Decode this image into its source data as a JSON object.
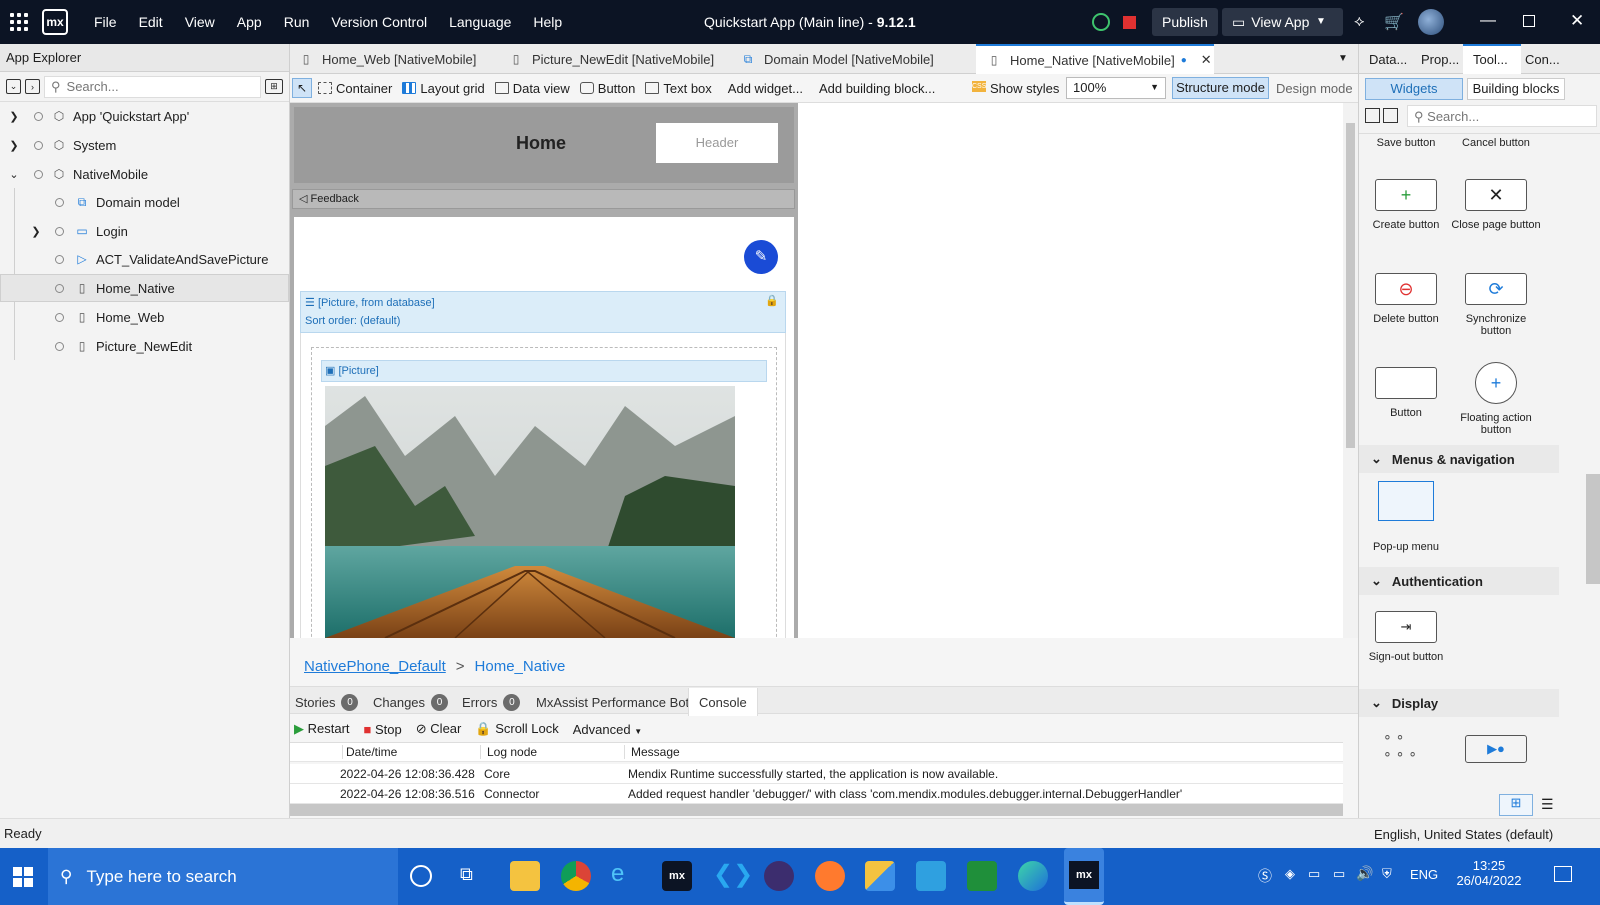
{
  "title_bar": {
    "menus": [
      "File",
      "Edit",
      "View",
      "App",
      "Run",
      "Version Control",
      "Language",
      "Help"
    ],
    "app_title": "Quickstart App (Main line)",
    "version": "9.12.1",
    "publish": "Publish",
    "view_app": "View App",
    "logo": "mx"
  },
  "explorer": {
    "header": "App Explorer",
    "search_placeholder": "Search...",
    "tree": [
      {
        "label": "App 'Quickstart App'",
        "icon": "app-icon"
      },
      {
        "label": "System",
        "icon": "module-icon"
      },
      {
        "label": "NativeMobile",
        "icon": "module-icon"
      },
      {
        "label": "Domain model",
        "icon": "domain-model-icon"
      },
      {
        "label": "Login",
        "icon": "folder-icon"
      },
      {
        "label": "ACT_ValidateAndSavePicture",
        "icon": "microflow-icon"
      },
      {
        "label": "Home_Native",
        "icon": "page-icon"
      },
      {
        "label": "Home_Web",
        "icon": "page-icon"
      },
      {
        "label": "Picture_NewEdit",
        "icon": "page-icon"
      }
    ]
  },
  "doc_tabs": [
    "Home_Web [NativeMobile]",
    "Picture_NewEdit [NativeMobile]",
    "Domain Model [NativeMobile]",
    "Home_Native [NativeMobile]"
  ],
  "toolbar": {
    "items": [
      "Container",
      "Layout grid",
      "Data view",
      "Button",
      "Text box",
      "Add widget...",
      "Add building block..."
    ],
    "show_styles": "Show styles",
    "zoom": "100%",
    "structure_mode": "Structure mode",
    "design_mode": "Design mode"
  },
  "page": {
    "title": "Home",
    "header_placeholder": "Header",
    "feedback": "Feedback",
    "list_source": "[Picture, from database]",
    "sort_order": "Sort order: (default)",
    "picture_label": "[Picture]"
  },
  "breadcrumb": {
    "layout": "NativePhone_Default",
    "separator": ">",
    "page": "Home_Native"
  },
  "right": {
    "tabs": [
      "Data...",
      "Prop...",
      "Tool...",
      "Con..."
    ],
    "subtabs": [
      "Widgets",
      "Building blocks"
    ],
    "search_placeholder": "Search...",
    "top_labels": [
      "Save button",
      "Cancel button"
    ],
    "widgets": [
      "Create button",
      "Close page button",
      "Delete button",
      "Synchronize button",
      "Button",
      "Floating action button"
    ],
    "sections": [
      "Menus & navigation",
      "Authentication",
      "Display"
    ],
    "popup": "Pop-up menu",
    "signout": "Sign-out button"
  },
  "bottom": {
    "tabs": [
      "Stories",
      "Changes",
      "Errors",
      "MxAssist Performance Bot",
      "Console"
    ],
    "badges": [
      "0",
      "0",
      "0"
    ],
    "actions": [
      "Restart",
      "Stop",
      "Clear",
      "Scroll Lock",
      "Advanced"
    ],
    "columns": [
      "Date/time",
      "Log node",
      "Message"
    ],
    "rows": [
      {
        "date": "2022-04-26 12:08:36.428",
        "node": "Core",
        "msg": "Mendix Runtime successfully started, the application is now available."
      },
      {
        "date": "2022-04-26 12:08:36.516",
        "node": "Connector",
        "msg": "Added request handler 'debugger/' with class 'com.mendix.modules.debugger.internal.DebuggerHandler'"
      }
    ]
  },
  "status": {
    "left": "Ready",
    "right": "English, United States (default)"
  },
  "taskbar": {
    "search": "Type here to search",
    "lang": "ENG",
    "time": "13:25",
    "date": "26/04/2022"
  }
}
